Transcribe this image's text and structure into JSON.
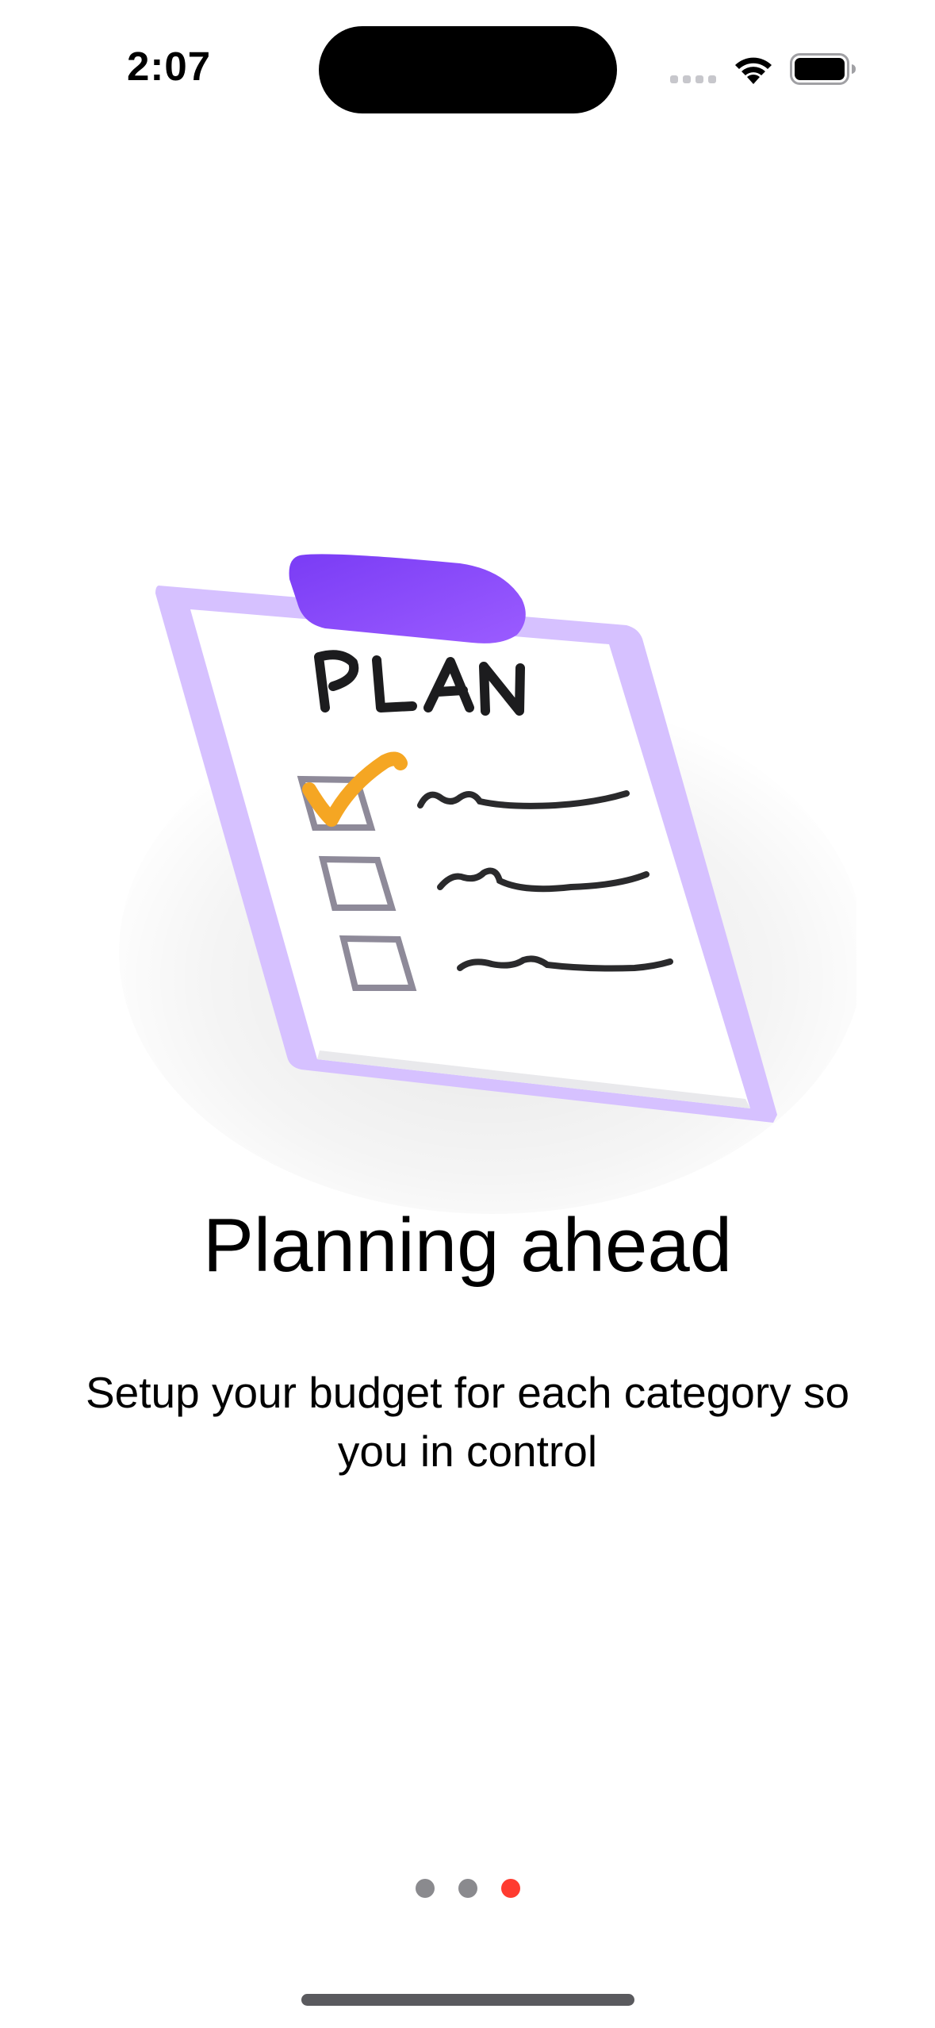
{
  "status_bar": {
    "time": "2:07",
    "icons": [
      "cellular-signal-icon",
      "wifi-icon",
      "battery-icon"
    ]
  },
  "illustration": {
    "name": "plan-clipboard-illustration",
    "heading_text": "PLAN",
    "checklist_items": 3,
    "checked_items": 1,
    "colors": {
      "clip": "#8b4dff",
      "frame": "#d7c2ff",
      "check": "#f5a623",
      "ink": "#1a1a1a"
    }
  },
  "onboarding": {
    "title": "Planning ahead",
    "subtitle": "Setup your budget for each category so you in control"
  },
  "pager": {
    "total_pages": 3,
    "current_page": 3,
    "colors": {
      "inactive": "#8a8a8e",
      "active": "#ff3b30"
    }
  }
}
